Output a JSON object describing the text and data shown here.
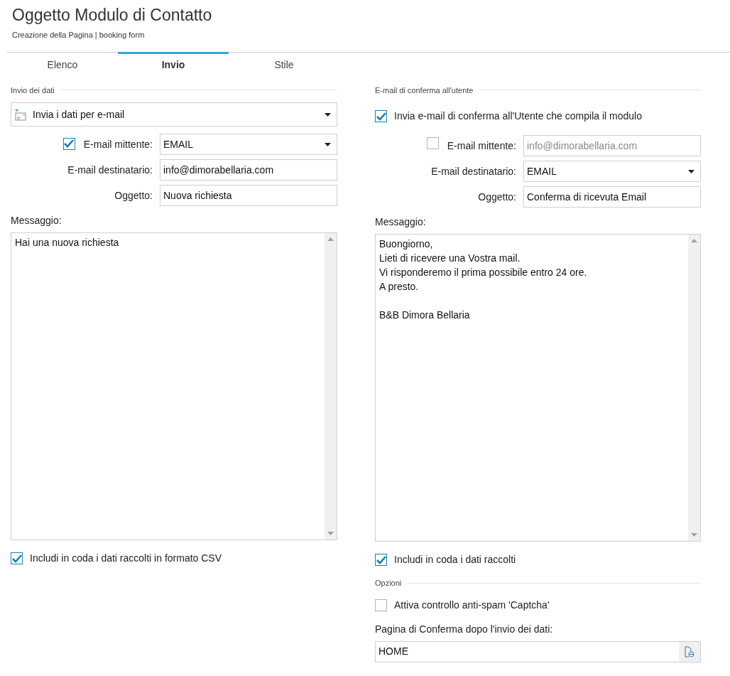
{
  "header": {
    "title": "Oggetto Modulo di Contatto",
    "subtitle": "Creazione della Pagina | booking form"
  },
  "tabs": [
    {
      "label": "Elenco",
      "selected": false
    },
    {
      "label": "Invio",
      "selected": true
    },
    {
      "label": "Stile",
      "selected": false
    }
  ],
  "left": {
    "section": "Invio dei dati",
    "send_method": {
      "value": "Invia i dati per e-mail"
    },
    "rows": [
      {
        "kind": "dropdown",
        "label": "E-mail mittente:",
        "checkbox": {
          "checked": true
        },
        "value": "EMAIL",
        "disabled": false
      },
      {
        "kind": "text",
        "label": "E-mail destinatario:",
        "value": "info@dimorabellaria.com",
        "disabled": false
      },
      {
        "kind": "text",
        "label": "Oggetto:",
        "value": "Nuova richiesta",
        "disabled": false
      }
    ],
    "message_label": "Messaggio:",
    "message": "Hai una nuova richiesta",
    "footer_checks": [
      {
        "label": "Includi in coda i dati raccolti in formato CSV",
        "checked": true
      }
    ]
  },
  "right": {
    "section": "E-mail di conferma all'utente",
    "enable": {
      "label": "Invia e-mail di conferma all'Utente che compila il modulo",
      "checked": true
    },
    "rows": [
      {
        "kind": "text",
        "label": "E-mail mittente:",
        "checkbox": {
          "checked": false
        },
        "value": "info@dimorabellaria.com",
        "disabled": true
      },
      {
        "kind": "dropdown",
        "label": "E-mail destinatario:",
        "value": "EMAIL",
        "disabled": false
      },
      {
        "kind": "text",
        "label": "Oggetto:",
        "value": "Conferma di ricevuta Email",
        "disabled": false
      }
    ],
    "message_label": "Messaggio:",
    "message": "Buongiorno,\nLieti di ricevere una Vostra mail.\nVi risponderemo il prima possibile entro 24 ore.\nA presto.\n\nB&B Dimora Bellaria",
    "footer_checks": [
      {
        "label": "Includi in coda i dati raccolti",
        "checked": true
      }
    ],
    "options": {
      "section": "Opzioni",
      "checks": [
        {
          "label": "Attiva controllo anti-spam 'Captcha'",
          "checked": false
        }
      ],
      "page_label": "Pagina di Conferma dopo l'invio dei dati:",
      "page_value": "HOME"
    }
  }
}
